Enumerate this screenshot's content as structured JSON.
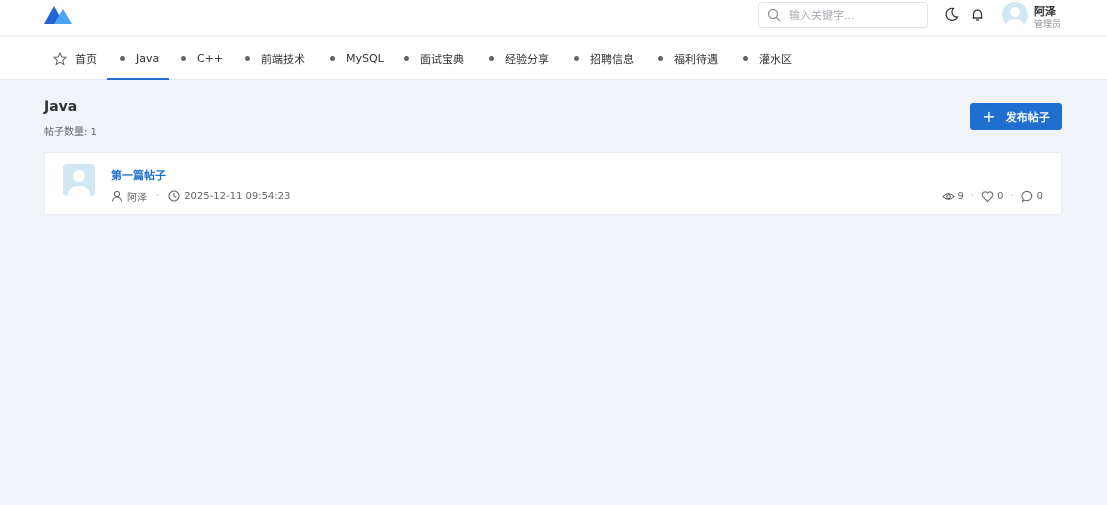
{
  "header": {
    "search_placeholder": "输入关键字...",
    "user": {
      "name": "阿泽",
      "role": "管理员"
    }
  },
  "nav": {
    "items": [
      {
        "label": "首页",
        "icon": "star-icon"
      },
      {
        "label": "Java",
        "active": true
      },
      {
        "label": "C++"
      },
      {
        "label": "前端技术"
      },
      {
        "label": "MySQL"
      },
      {
        "label": "面试宝典"
      },
      {
        "label": "经验分享"
      },
      {
        "label": "招聘信息"
      },
      {
        "label": "福利待遇"
      },
      {
        "label": "灌水区"
      }
    ]
  },
  "page": {
    "title": "Java",
    "post_count_label": "帖子数量: 1",
    "publish_button": "发布帖子"
  },
  "posts": [
    {
      "title": "第一篇帖子",
      "author": "阿泽",
      "time": "2025-12-11 09:54:23",
      "views": "9",
      "likes": "0",
      "comments": "0"
    }
  ],
  "colors": {
    "accent": "#1f6fd1",
    "background": "#f0f3f8",
    "logo_dark": "#2463d8",
    "logo_light": "#4aa3f5"
  }
}
